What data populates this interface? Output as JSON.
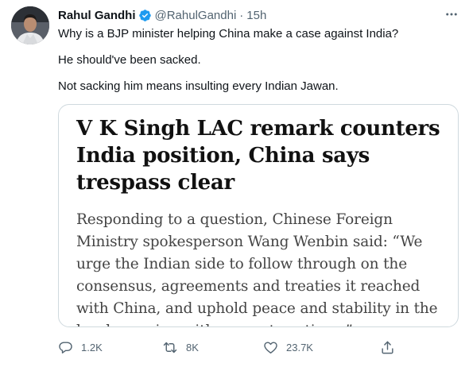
{
  "author": {
    "name": "Rahul Gandhi",
    "handle": "@RahulGandhi",
    "separator": "·",
    "time": "15h"
  },
  "tweet": {
    "lines": [
      "Why is a BJP minister helping China make a case against India?",
      "He should've been sacked.",
      "Not sacking him means insulting every Indian Jawan."
    ]
  },
  "card": {
    "headline": "V K Singh LAC remark counters India position, China says trespass clear",
    "body": "Responding to a question, Chinese Foreign Ministry spokesperson Wang Wenbin said: “We urge the Indian side to follow through on the consensus, agreements and treaties it reached with China, and uphold peace and stability in the border region with concrete actions.”"
  },
  "actions": {
    "replies": "1.2K",
    "retweets": "8K",
    "likes": "23.7K"
  },
  "colors": {
    "verified": "#1d9bf0",
    "muted": "#536471",
    "border": "#cfd9de"
  },
  "icons": [
    "verified-badge-icon",
    "more-icon",
    "reply-icon",
    "retweet-icon",
    "like-icon",
    "share-icon"
  ]
}
